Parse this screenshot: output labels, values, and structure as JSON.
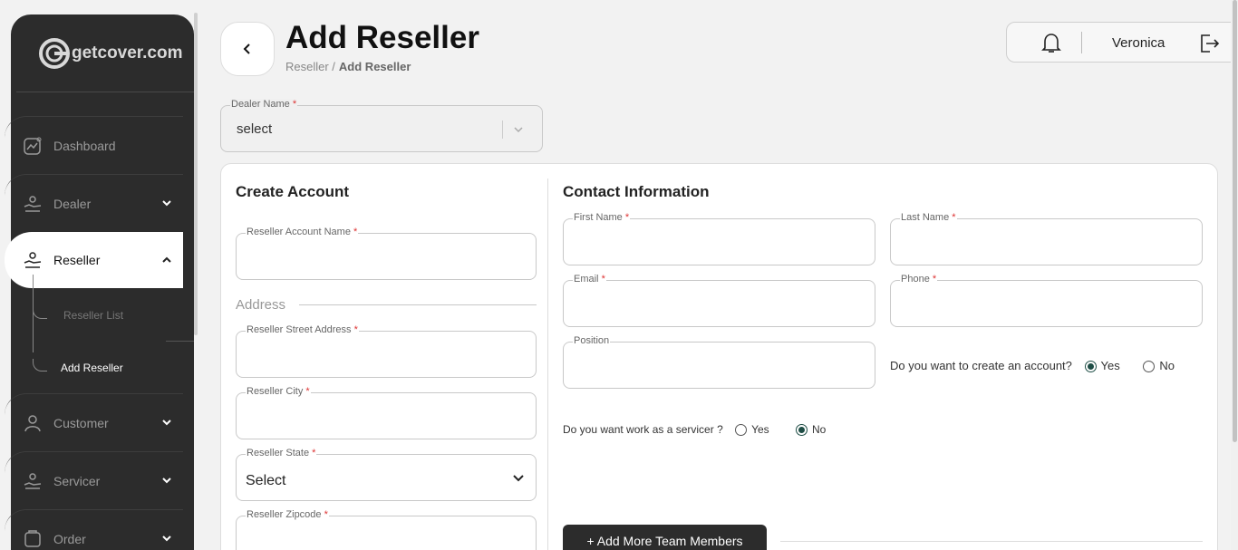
{
  "brand": {
    "logo_text": "getcover.com"
  },
  "sidebar": {
    "items": [
      {
        "label": "Dashboard",
        "icon": "dashboard-icon"
      },
      {
        "label": "Dealer",
        "icon": "dealer-icon"
      },
      {
        "label": "Reseller",
        "icon": "reseller-icon"
      },
      {
        "label": "Customer",
        "icon": "customer-icon"
      },
      {
        "label": "Servicer",
        "icon": "servicer-icon"
      },
      {
        "label": "Order",
        "icon": "order-icon"
      }
    ],
    "sub_items": [
      "Reseller List",
      "Add Reseller"
    ]
  },
  "header": {
    "title": "Add Reseller",
    "breadcrumb_root": "Reseller /",
    "breadcrumb_current": "Add Reseller",
    "user_name": "Veronica"
  },
  "dealer": {
    "label": "Dealer Name",
    "value": "select"
  },
  "create_account": {
    "title": "Create Account",
    "account_name_label": "Reseller Account Name",
    "address_heading": "Address",
    "street_label": "Reseller Street Address",
    "city_label": "Reseller City",
    "state_label": "Reseller State",
    "state_value": "Select",
    "zip_label": "Reseller Zipcode"
  },
  "contact": {
    "title": "Contact Information",
    "first_name_label": "First Name",
    "last_name_label": "Last Name",
    "email_label": "Email",
    "phone_label": "Phone",
    "position_label": "Position",
    "create_account_q": "Do you want to create an account?",
    "servicer_q": "Do you want work as a servicer ?",
    "yes": "Yes",
    "no": "No",
    "add_members": "+ Add More Team Members"
  },
  "required_mark": "*"
}
